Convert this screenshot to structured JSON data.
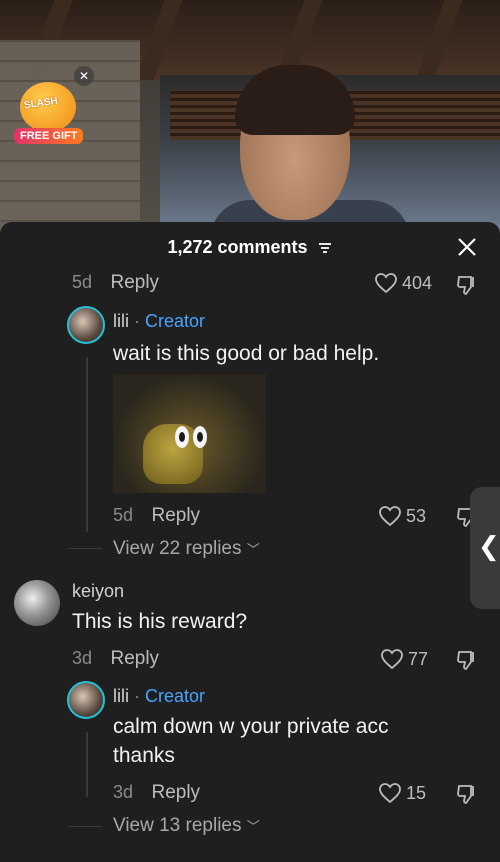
{
  "video": {
    "gift": {
      "badge_text": "SLASH",
      "label": "FREE GIFT",
      "close": "✕"
    }
  },
  "panel": {
    "title": "1,272 comments",
    "close": "✕"
  },
  "comments": [
    {
      "type": "footer",
      "age": "5d",
      "reply": "Reply",
      "likes": "404"
    },
    {
      "type": "reply",
      "author": "lili",
      "badge": "Creator",
      "text": "wait is this good or bad help.",
      "age": "5d",
      "reply": "Reply",
      "likes": "53",
      "view_replies": "View 22 replies"
    },
    {
      "type": "comment",
      "author": "keiyon",
      "text": "This is his reward?",
      "age": "3d",
      "reply": "Reply",
      "likes": "77"
    },
    {
      "type": "reply",
      "author": "lili",
      "badge": "Creator",
      "text_line1": "calm down w your private acc",
      "text_line2": "thanks",
      "age": "3d",
      "reply": "Reply",
      "likes": "15",
      "view_replies": "View 13 replies"
    }
  ],
  "side_tab": {
    "icon": "chevron-left-icon",
    "glyph": "❮"
  },
  "colors": {
    "accent_creator": "#4aa3ff",
    "avatar_ring": "#25c2d6",
    "panel_bg": "#1f1f1f"
  }
}
